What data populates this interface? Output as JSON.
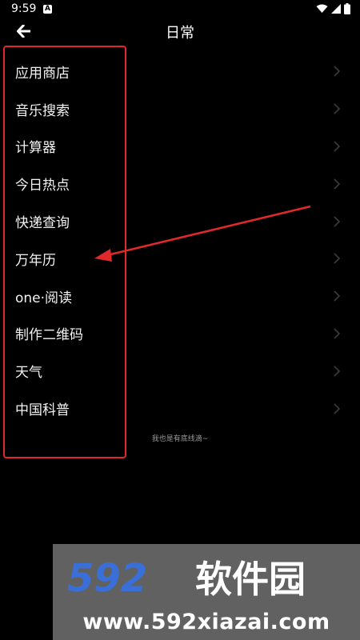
{
  "status_bar": {
    "time": "9:59",
    "notification_icon": "a-letter-icon",
    "wifi_icon": "wifi-icon",
    "signal_icon": "signal-icon",
    "battery_icon": "battery-icon"
  },
  "header": {
    "back_icon": "arrow-left-icon",
    "title": "日常"
  },
  "menu": {
    "items": [
      {
        "label": "应用商店"
      },
      {
        "label": "音乐搜索"
      },
      {
        "label": "计算器"
      },
      {
        "label": "今日热点"
      },
      {
        "label": "快递查询"
      },
      {
        "label": "万年历"
      },
      {
        "label": "one·阅读"
      },
      {
        "label": "制作二维码"
      },
      {
        "label": "天气"
      },
      {
        "label": "中国科普"
      }
    ],
    "chevron_icon": "chevron-right-icon"
  },
  "footer_note": "我也是有底线滴~",
  "annotation": {
    "highlight_color": "#e0292b",
    "arrow_color": "#e0292b"
  },
  "watermark": {
    "logo_text": "592软件园",
    "url": "www.592xiazai.com",
    "logo_color": "#3a6fd8"
  }
}
